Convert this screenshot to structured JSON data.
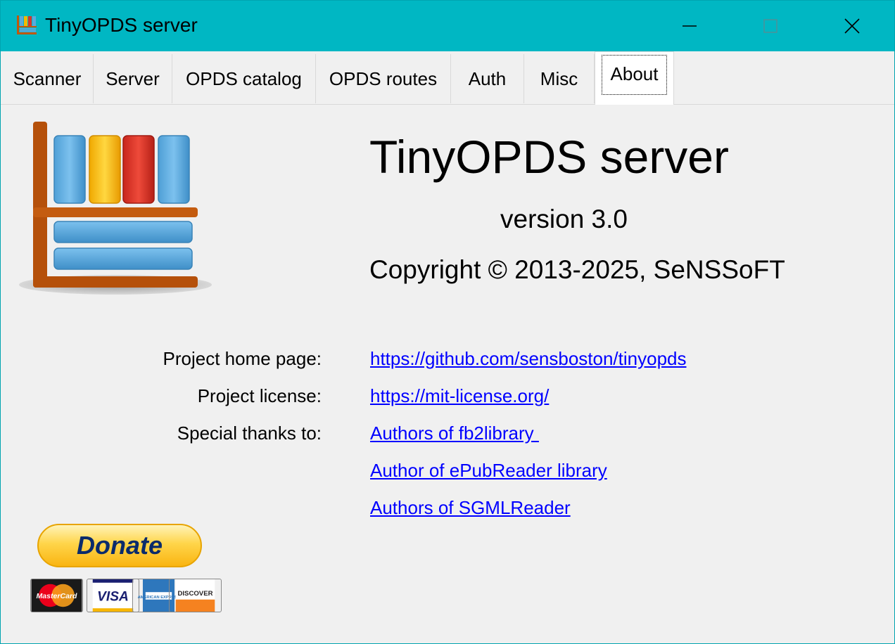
{
  "window": {
    "title": "TinyOPDS server"
  },
  "tabs": [
    {
      "label": "Scanner"
    },
    {
      "label": "Server"
    },
    {
      "label": "OPDS catalog"
    },
    {
      "label": "OPDS routes"
    },
    {
      "label": "Auth"
    },
    {
      "label": "Misc"
    },
    {
      "label": "About",
      "active": true
    }
  ],
  "about": {
    "app_name": "TinyOPDS server",
    "version": "version 3.0",
    "copyright": "Copyright © 2013-2025, SeNSSoFT",
    "home_label": "Project home page:",
    "home_url": "https://github.com/sensboston/tinyopds",
    "license_label": "Project license:",
    "license_url": "https://mit-license.org/",
    "thanks_label": "Special thanks to:",
    "thanks": [
      "Authors of fb2library ",
      "Author of ePubReader library",
      "Authors of SGMLReader"
    ]
  },
  "donate": {
    "label": "Donate",
    "cards": [
      "MasterCard",
      "VISA",
      "AMERICAN EXPRESS",
      "DISCOVER"
    ]
  },
  "colors": {
    "titlebar": "#00b7c3",
    "link": "#0000ff",
    "panel": "#f0f0f0"
  }
}
